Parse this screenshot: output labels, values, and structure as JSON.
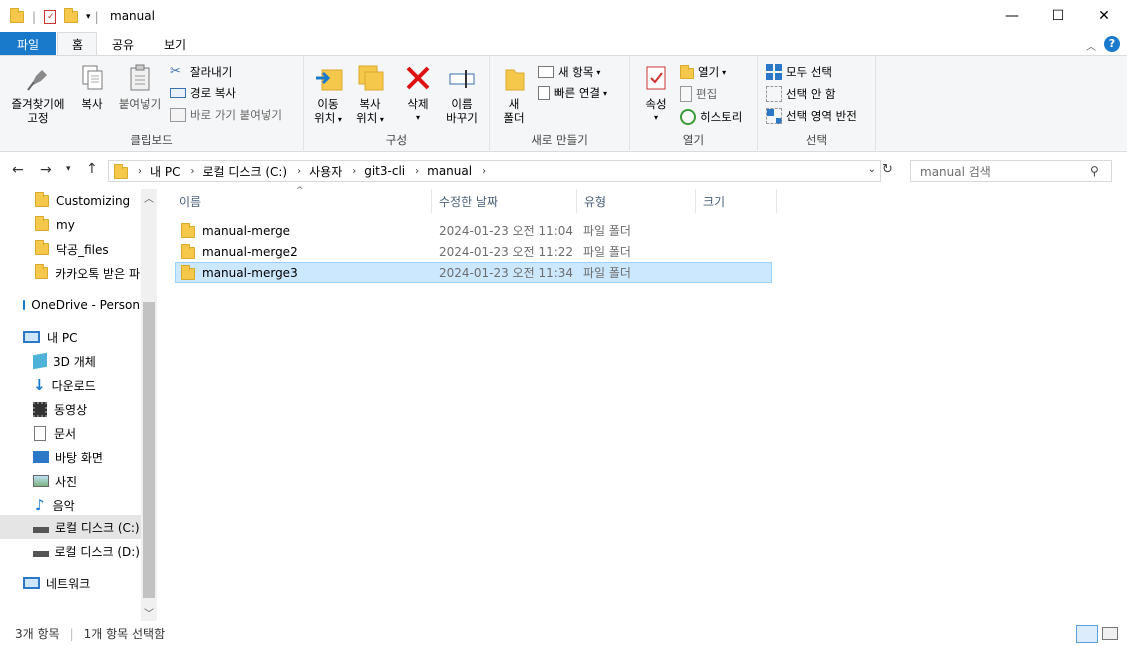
{
  "window": {
    "title": "manual",
    "minimize": "—",
    "maximize": "☐",
    "close": "✕"
  },
  "tabs": {
    "file": "파일",
    "home": "홈",
    "share": "공유",
    "view": "보기"
  },
  "ribbon": {
    "clipboard": {
      "pin": "즐겨찾기에 고정",
      "pin1": "즐겨찾기에",
      "pin2": "고정",
      "copy": "복사",
      "paste": "붙여넣기",
      "cut": "잘라내기",
      "copy_path": "경로 복사",
      "paste_shortcut": "바로 가기 붙여넣기",
      "label": "클립보드"
    },
    "organize": {
      "move1": "이동",
      "move2": "위치",
      "copyto1": "복사",
      "copyto2": "위치",
      "delete": "삭제",
      "rename1": "이름",
      "rename2": "바꾸기",
      "label": "구성"
    },
    "new": {
      "folder1": "새",
      "folder2": "폴더",
      "new_item": "새 항목",
      "easy_access": "빠른 연결",
      "label": "새로 만들기"
    },
    "open": {
      "properties": "속성",
      "open": "열기",
      "edit": "편집",
      "history": "히스토리",
      "label": "열기"
    },
    "select": {
      "all": "모두 선택",
      "none": "선택 안 함",
      "invert": "선택 영역 반전",
      "label": "선택"
    }
  },
  "address": {
    "crumbs": [
      "내 PC",
      "로컬 디스크 (C:)",
      "사용자",
      "git3-cli",
      "manual"
    ],
    "search_placeholder": "manual 검색"
  },
  "nav": {
    "quick": [
      "Customizing",
      "my",
      "닥공_files",
      "카카오톡 받은 파"
    ],
    "onedrive": "OneDrive - Person",
    "pc": "내 PC",
    "pc_items": [
      "3D 개체",
      "다운로드",
      "동영상",
      "문서",
      "바탕 화면",
      "사진",
      "음악",
      "로컬 디스크 (C:)",
      "로컬 디스크 (D:)"
    ],
    "network": "네트워크"
  },
  "columns": {
    "name": "이름",
    "modified": "수정한 날짜",
    "type": "유형",
    "size": "크기"
  },
  "files": [
    {
      "name": "manual-merge",
      "modified": "2024-01-23 오전 11:04",
      "type": "파일 폴더"
    },
    {
      "name": "manual-merge2",
      "modified": "2024-01-23 오전 11:22",
      "type": "파일 폴더"
    },
    {
      "name": "manual-merge3",
      "modified": "2024-01-23 오전 11:34",
      "type": "파일 폴더"
    }
  ],
  "status": {
    "count": "3개 항목",
    "selected": "1개 항목 선택함"
  },
  "colors": {
    "accent": "#1979ca",
    "selection": "#cce8ff",
    "folder": "#f5c84c"
  }
}
